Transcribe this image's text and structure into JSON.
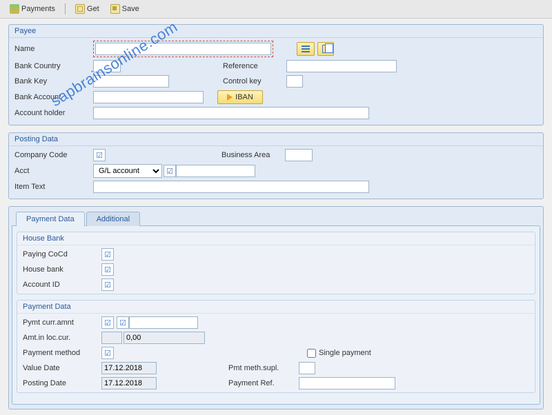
{
  "toolbar": {
    "payments": "Payments",
    "get": "Get",
    "save": "Save"
  },
  "payee": {
    "title": "Payee",
    "name_label": "Name",
    "name_value": "",
    "bank_country_label": "Bank Country",
    "bank_country_value": "",
    "reference_label": "Reference",
    "reference_value": "",
    "bank_key_label": "Bank Key",
    "bank_key_value": "",
    "control_key_label": "Control key",
    "control_key_value": "",
    "bank_account_label": "Bank Account",
    "bank_account_value": "",
    "iban_button": "IBAN",
    "account_holder_label": "Account holder",
    "account_holder_value": ""
  },
  "posting": {
    "title": "Posting Data",
    "company_code_label": "Company Code",
    "company_code_checked": true,
    "business_area_label": "Business Area",
    "business_area_value": "",
    "acct_label": "Acct",
    "acct_dropdown": "G/L account",
    "acct_extra_checked": true,
    "item_text_label": "Item Text",
    "item_text_value": ""
  },
  "tabs": {
    "payment_data": "Payment Data",
    "additional": "Additional"
  },
  "house_bank": {
    "title": "House Bank",
    "paying_cocd_label": "Paying CoCd",
    "paying_cocd_checked": true,
    "house_bank_label": "House bank",
    "house_bank_checked": true,
    "account_id_label": "Account ID",
    "account_id_checked": true
  },
  "payment_data": {
    "title": "Payment Data",
    "pymt_curr_amnt_label": "Pymt curr.amnt",
    "pymt_curr_checked": true,
    "pymt_curr_extra_checked": true,
    "pymt_extra_value": "",
    "amt_loc_label": "Amt.in loc.cur.",
    "amt_loc_blank": "",
    "amt_loc_value": "0,00",
    "payment_method_label": "Payment method",
    "payment_method_checked": true,
    "single_payment_label": "Single payment",
    "value_date_label": "Value Date",
    "value_date_value": "17.12.2018",
    "pmt_meth_supl_label": "Pmt meth.supl.",
    "pmt_meth_supl_value": "",
    "posting_date_label": "Posting Date",
    "posting_date_value": "17.12.2018",
    "payment_ref_label": "Payment Ref.",
    "payment_ref_value": ""
  },
  "watermark": "sapbrainsonline.com"
}
